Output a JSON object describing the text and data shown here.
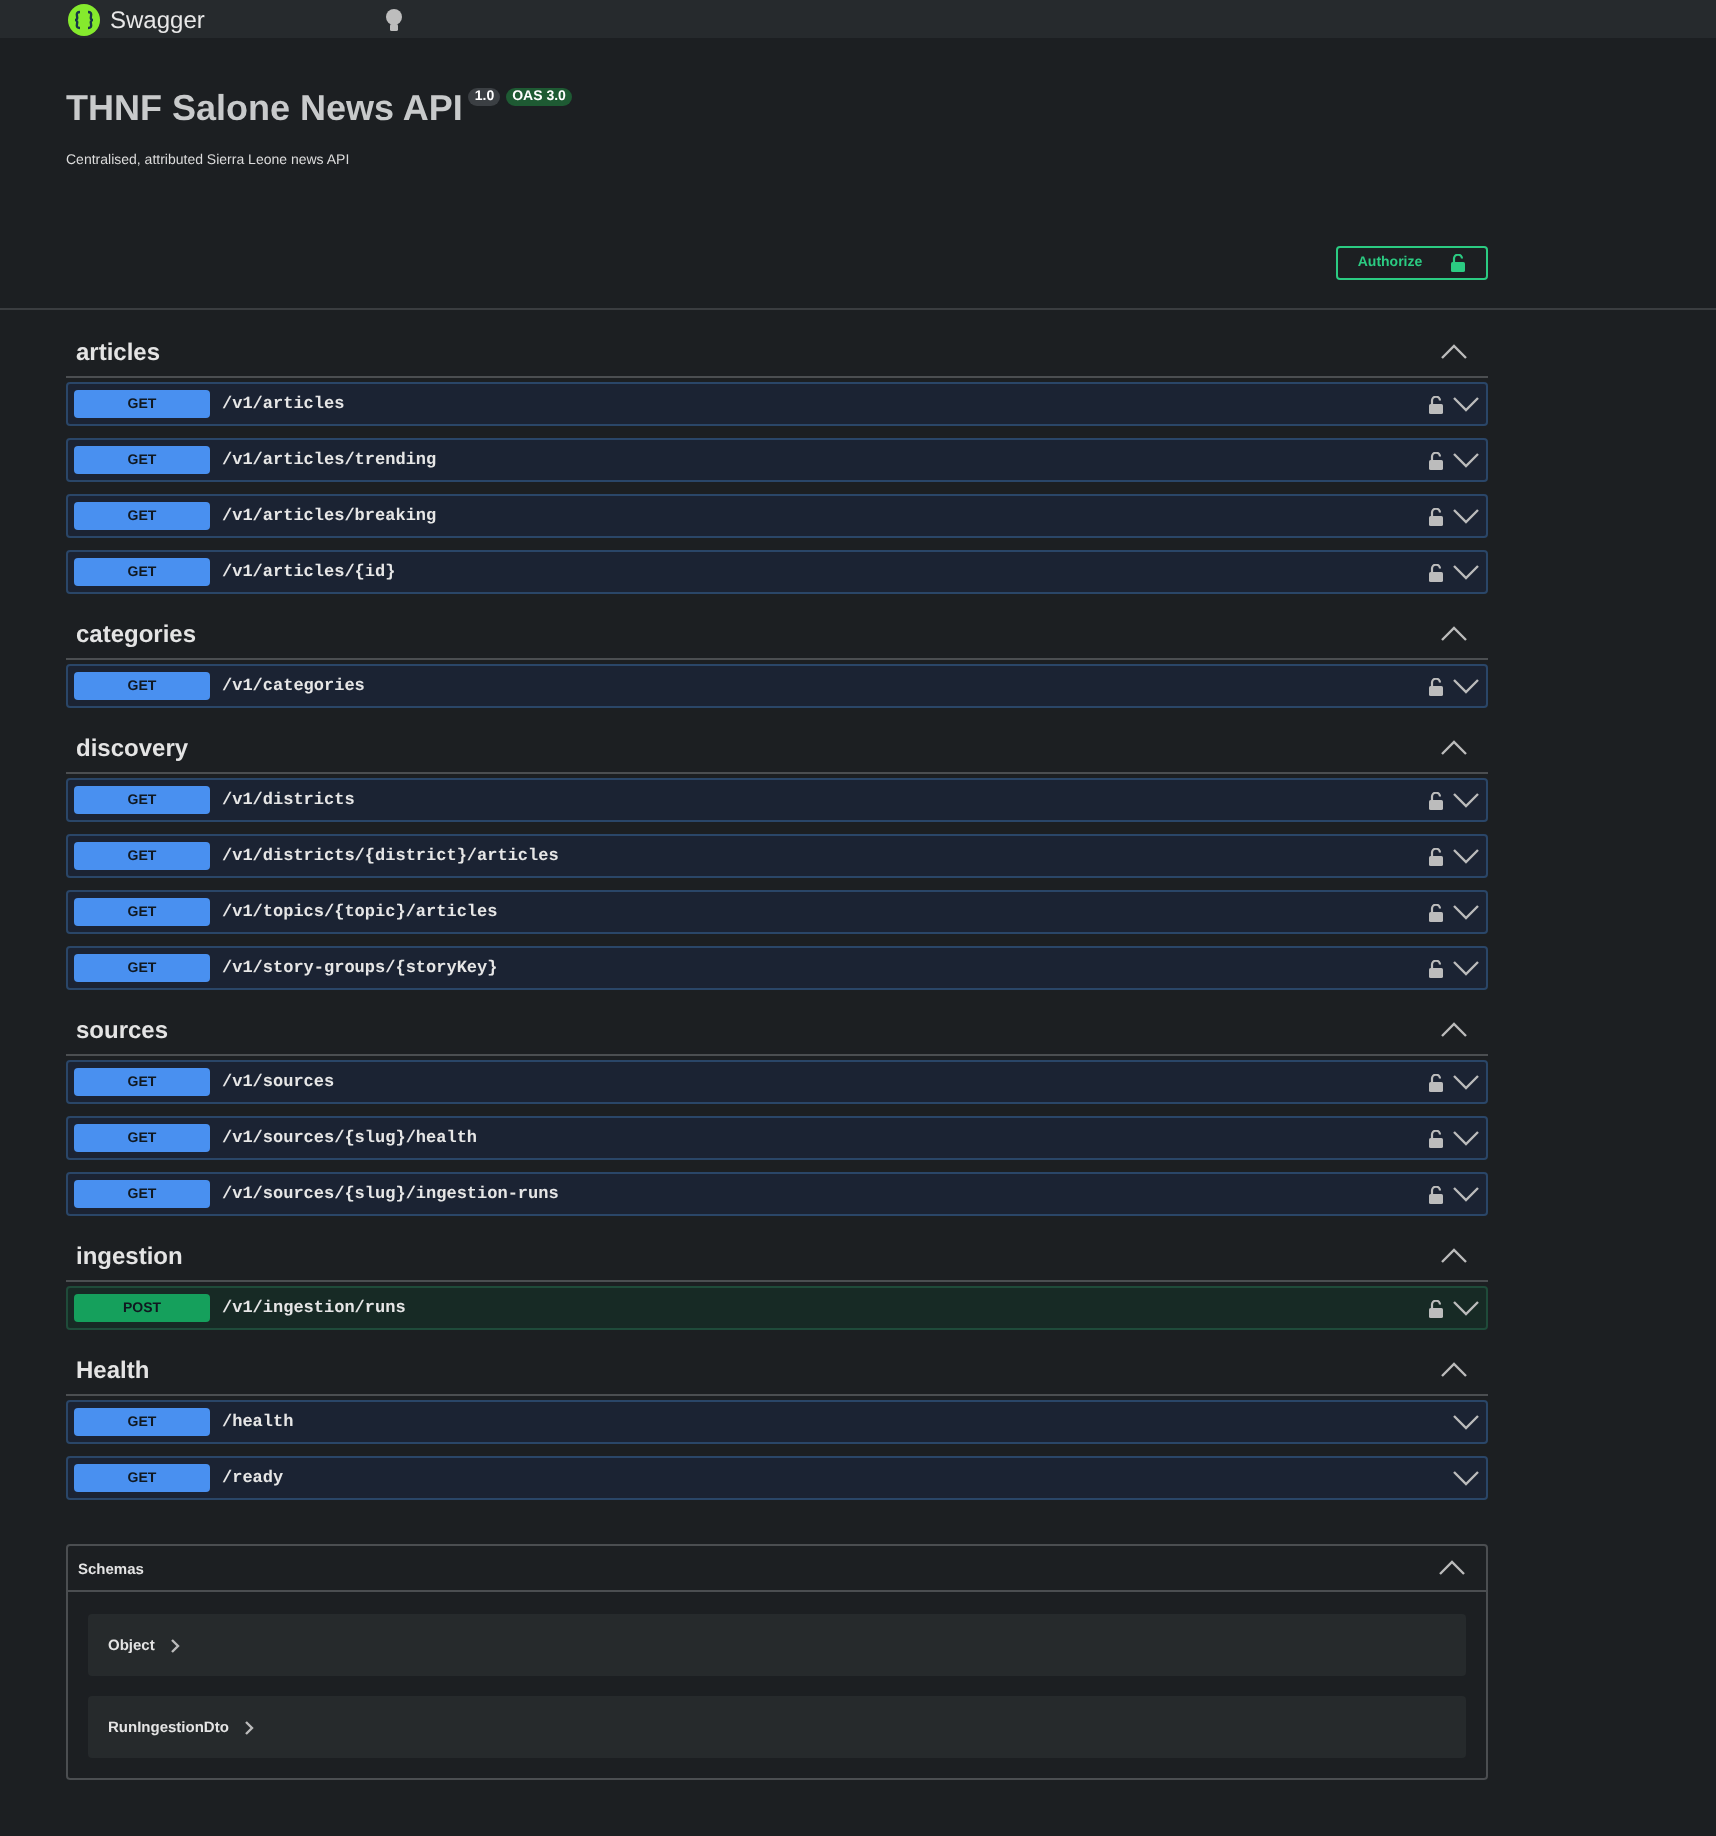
{
  "topbar": {
    "logo_text": "Swagger"
  },
  "info": {
    "title": "THNF Salone News API",
    "version": "1.0",
    "oas": "OAS 3.0",
    "description": "Centralised, attributed Sierra Leone news API"
  },
  "authorize": {
    "label": "Authorize"
  },
  "sections": [
    {
      "name": "articles",
      "expanded": true,
      "operations": [
        {
          "method": "GET",
          "path": "/v1/articles",
          "secured": true
        },
        {
          "method": "GET",
          "path": "/v1/articles/trending",
          "secured": true
        },
        {
          "method": "GET",
          "path": "/v1/articles/breaking",
          "secured": true
        },
        {
          "method": "GET",
          "path": "/v1/articles/{id}",
          "secured": true
        }
      ]
    },
    {
      "name": "categories",
      "expanded": true,
      "operations": [
        {
          "method": "GET",
          "path": "/v1/categories",
          "secured": true
        }
      ]
    },
    {
      "name": "discovery",
      "expanded": true,
      "operations": [
        {
          "method": "GET",
          "path": "/v1/districts",
          "secured": true
        },
        {
          "method": "GET",
          "path": "/v1/districts/{district}/articles",
          "secured": true
        },
        {
          "method": "GET",
          "path": "/v1/topics/{topic}/articles",
          "secured": true
        },
        {
          "method": "GET",
          "path": "/v1/story-groups/{storyKey}",
          "secured": true
        }
      ]
    },
    {
      "name": "sources",
      "expanded": true,
      "operations": [
        {
          "method": "GET",
          "path": "/v1/sources",
          "secured": true
        },
        {
          "method": "GET",
          "path": "/v1/sources/{slug}/health",
          "secured": true
        },
        {
          "method": "GET",
          "path": "/v1/sources/{slug}/ingestion-runs",
          "secured": true
        }
      ]
    },
    {
      "name": "ingestion",
      "expanded": true,
      "operations": [
        {
          "method": "POST",
          "path": "/v1/ingestion/runs",
          "secured": true
        }
      ]
    },
    {
      "name": "Health",
      "expanded": true,
      "operations": [
        {
          "method": "GET",
          "path": "/health",
          "secured": false
        },
        {
          "method": "GET",
          "path": "/ready",
          "secured": false
        }
      ]
    }
  ],
  "schemas": {
    "title": "Schemas",
    "expanded": true,
    "items": [
      {
        "name": "Object",
        "expanded": false
      },
      {
        "name": "RunIngestionDto",
        "expanded": false
      }
    ]
  }
}
